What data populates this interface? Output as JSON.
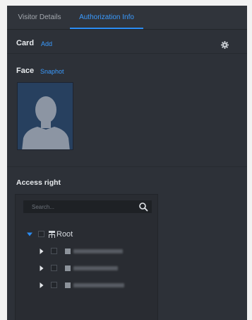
{
  "tabs": [
    {
      "label": "Visitor Details"
    },
    {
      "label": "Authorization Info"
    }
  ],
  "card": {
    "label": "Card",
    "add_link": "Add"
  },
  "face": {
    "label": "Face",
    "snapshot_link": "Snaphot"
  },
  "access": {
    "title": "Access right",
    "search_placeholder": "Search...",
    "root_label": "Root",
    "devices": [
      {
        "label": ""
      },
      {
        "label": ""
      },
      {
        "label": ""
      }
    ]
  },
  "colors": {
    "panel_bg": "#2d3138",
    "accent": "#2b8cf2",
    "link": "#3a9bff",
    "text": "#e9ecef"
  },
  "icons": [
    "gear-icon",
    "search-icon",
    "expand-down-icon",
    "expand-right-icon",
    "organization-icon",
    "device-icon"
  ]
}
